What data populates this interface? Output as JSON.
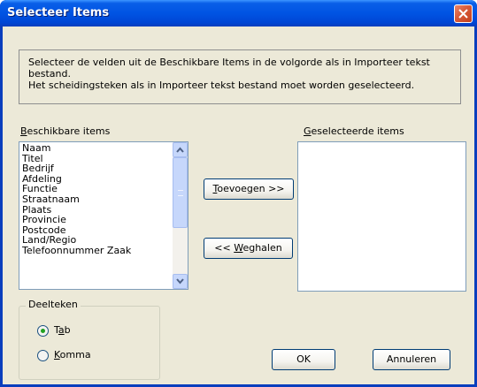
{
  "window": {
    "title": "Selecteer Items"
  },
  "info": {
    "line1": "Selecteer de velden uit de Beschikbare Items in de volgorde als in Importeer tekst bestand.",
    "line2": "Het scheidingsteken als in Importeer tekst bestand moet worden geselecteerd."
  },
  "available": {
    "label_hotkey": "B",
    "label_rest": "eschikbare items",
    "items": [
      "Naam",
      "Titel",
      "Bedrijf",
      "Afdeling",
      "Functie",
      "Straatnaam",
      "Plaats",
      "Provincie",
      "Postcode",
      "Land/Regio",
      "Telefoonnummer Zaak"
    ]
  },
  "selected": {
    "label_hotkey": "G",
    "label_rest": "eselecteerde items"
  },
  "buttons": {
    "add_hotkey": "T",
    "add_rest": "oevoegen >>",
    "remove_prefix": "<< ",
    "remove_hotkey": "W",
    "remove_rest": "eghalen",
    "ok": "OK",
    "cancel": "Annuleren"
  },
  "separator": {
    "title": "Deelteken",
    "tab_prefix": "T",
    "tab_hotkey": "a",
    "tab_rest": "b",
    "comma_hotkey": "K",
    "comma_rest": "omma",
    "selected": "Tab"
  },
  "colors": {
    "titlebar": "#0054e3",
    "client": "#ece9d8",
    "radio_dot": "#21a121",
    "close": "#d85a38"
  },
  "icons": [
    "close-icon",
    "scroll-up-arrow-icon",
    "scroll-down-arrow-icon",
    "scroll-thumb-grip-icon"
  ]
}
